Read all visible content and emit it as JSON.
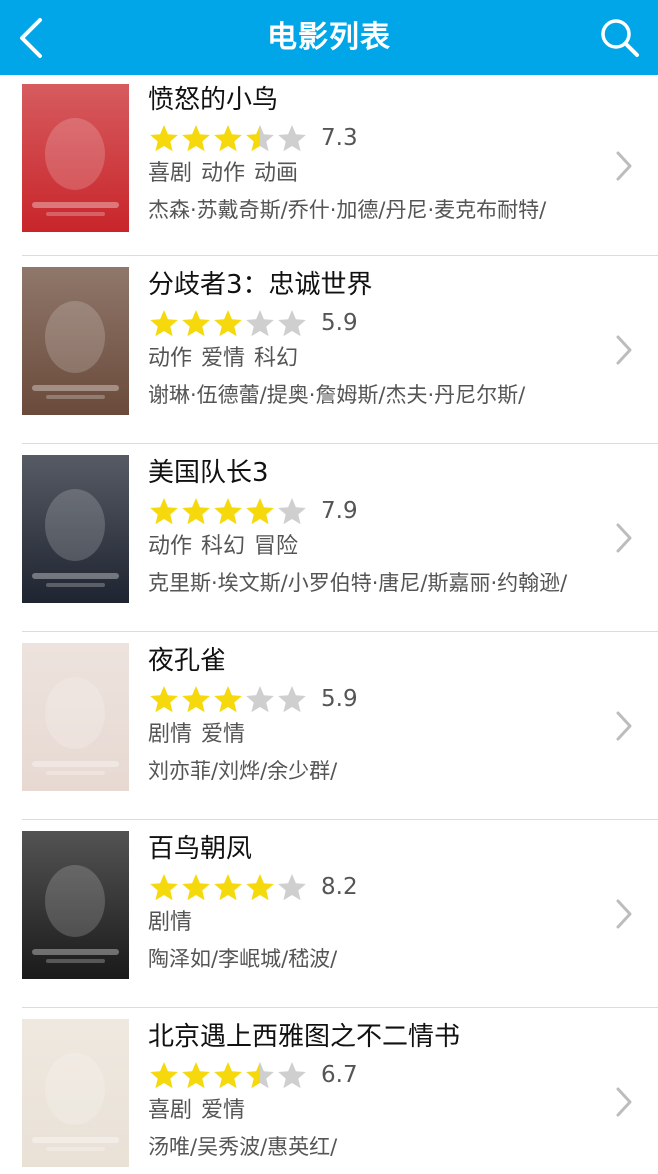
{
  "header": {
    "title": "电影列表",
    "bg_color": "#00a6e8",
    "back_icon": "back-arrow-icon",
    "search_icon": "search-icon"
  },
  "movies": [
    {
      "title": "愤怒的小鸟",
      "rating": 7.3,
      "rating_text": "7.3",
      "stars": 3.5,
      "genres": "喜剧 动作 动画",
      "cast": "杰森·苏戴奇斯/乔什·加德/丹尼·麦克布耐特/",
      "poster_color": "#c8252a"
    },
    {
      "title": "分歧者3：忠诚世界",
      "rating": 5.9,
      "rating_text": "5.9",
      "stars": 3,
      "genres": "动作 爱情 科幻",
      "cast": "谢琳·伍德蕾/提奥·詹姆斯/杰夫·丹尼尔斯/",
      "poster_color": "#6a4a3a"
    },
    {
      "title": "美国队长3",
      "rating": 7.9,
      "rating_text": "7.9",
      "stars": 4,
      "genres": "动作 科幻 冒险",
      "cast": "克里斯·埃文斯/小罗伯特·唐尼/斯嘉丽·约翰逊/",
      "poster_color": "#1e2430"
    },
    {
      "title": "夜孔雀",
      "rating": 5.9,
      "rating_text": "5.9",
      "stars": 3,
      "genres": "剧情 爱情",
      "cast": "刘亦菲/刘烨/余少群/",
      "poster_color": "#e7d9d2"
    },
    {
      "title": "百鸟朝凤",
      "rating": 8.2,
      "rating_text": "8.2",
      "stars": 4,
      "genres": "剧情",
      "cast": "陶泽如/李岷城/嵇波/",
      "poster_color": "#1a1a1a"
    },
    {
      "title": "北京遇上西雅图之不二情书",
      "rating": 6.7,
      "rating_text": "6.7",
      "stars": 3.5,
      "genres": "喜剧 爱情",
      "cast": "汤唯/吴秀波/惠英红/",
      "poster_color": "#e9e1d6"
    }
  ],
  "colors": {
    "star_on": "#f5d90d",
    "star_off": "#cfcfcf",
    "chevron": "#bdbdbd"
  }
}
